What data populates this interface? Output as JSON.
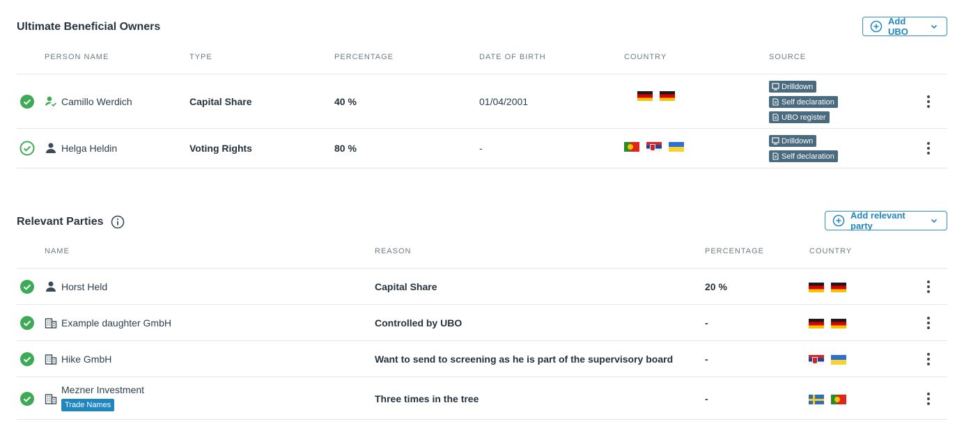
{
  "ubo": {
    "title": "Ultimate Beneficial Owners",
    "add_label": "Add UBO",
    "headers": [
      "PERSON NAME",
      "TYPE",
      "PERCENTAGE",
      "DATE OF BIRTH",
      "COUNTRY",
      "SOURCE"
    ],
    "rows": [
      {
        "name": "Camillo Werdich",
        "type": "Capital Share",
        "percentage": "40 %",
        "dob": "01/04/2001",
        "flags": [
          "de",
          "de"
        ],
        "sources": [
          "Drilldown",
          "Self declaration",
          "UBO register"
        ],
        "icon": "person-check-icon"
      },
      {
        "name": "Helga Heldin",
        "type": "Voting Rights",
        "percentage": "80 %",
        "dob": "-",
        "flags": [
          "pt",
          "rs",
          "ua"
        ],
        "sources": [
          "Drilldown",
          "Self declaration"
        ],
        "icon": "person-icon"
      }
    ]
  },
  "parties": {
    "title": "Relevant Parties",
    "add_label": "Add relevant party",
    "headers": [
      "NAME",
      "REASON",
      "PERCENTAGE",
      "COUNTRY"
    ],
    "rows": [
      {
        "name": "Horst Held",
        "reason": "Capital Share",
        "percentage": "20 %",
        "flags": [
          "de",
          "de"
        ],
        "icon": "person-icon"
      },
      {
        "name": "Example daughter GmbH",
        "reason": "Controlled by UBO",
        "percentage": "-",
        "flags": [
          "de",
          "de"
        ],
        "icon": "building-icon"
      },
      {
        "name": "Hike GmbH",
        "reason": "Want to send to screening as he is part of the supervisory board",
        "percentage": "-",
        "flags": [
          "rs",
          "ua"
        ],
        "icon": "building-icon"
      },
      {
        "name": "Mezner Investment",
        "tag": "Trade Names",
        "reason": "Three times in the tree",
        "percentage": "-",
        "flags": [
          "se",
          "pt"
        ],
        "icon": "building-icon"
      }
    ]
  },
  "colors": {
    "accent": "#1f86c0",
    "check": "#3daa55",
    "tag_bg": "#4a6a80"
  }
}
